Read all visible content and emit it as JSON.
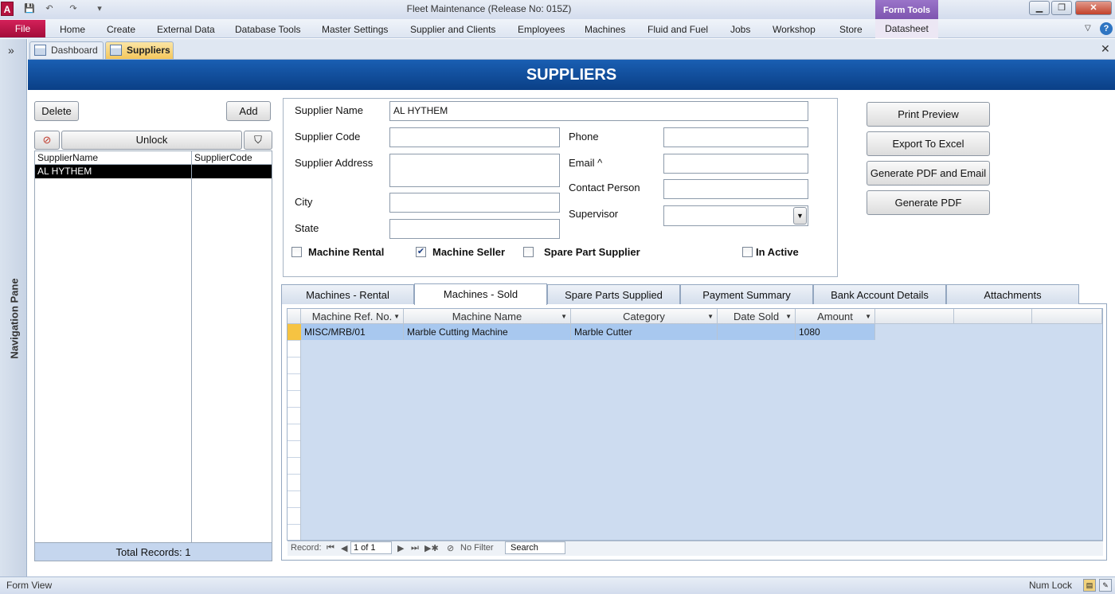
{
  "window": {
    "title": "Fleet Maintenance (Release No: 015Z)",
    "context_tab_group": "Form Tools",
    "app_icon_letter": "A"
  },
  "ribbon": {
    "file": "File",
    "tabs": [
      "Home",
      "Create",
      "External Data",
      "Database Tools",
      "Master Settings",
      "Supplier and Clients",
      "Employees",
      "Machines",
      "Fluid and Fuel",
      "Jobs",
      "Workshop",
      "Store"
    ],
    "context_tab": "Datasheet"
  },
  "nav_pane": {
    "label": "Navigation Pane",
    "toggle": "»"
  },
  "doc_tabs": [
    "Dashboard",
    "Suppliers"
  ],
  "header": {
    "title": "SUPPLIERS"
  },
  "left": {
    "delete_label": "Delete",
    "add_label": "Add",
    "unlock_label": "Unlock",
    "columns": [
      "SupplierName",
      "SupplierCode"
    ],
    "rows": [
      {
        "name": "AL HYTHEM",
        "code": ""
      }
    ],
    "total_records": "Total Records: 1"
  },
  "form": {
    "supplier_name_label": "Supplier Name",
    "supplier_name_value": "AL HYTHEM",
    "supplier_code_label": "Supplier Code",
    "supplier_code_value": "",
    "supplier_address_label": "Supplier Address",
    "supplier_address_value": "",
    "city_label": "City",
    "city_value": "",
    "state_label": "State",
    "state_value": "",
    "phone_label": "Phone",
    "phone_value": "",
    "email_label": "Email ^",
    "email_value": "",
    "contact_label": "Contact Person",
    "contact_value": "",
    "supervisor_label": "Supervisor",
    "supervisor_value": "",
    "checkboxes": [
      {
        "label": "Machine Rental",
        "checked": false
      },
      {
        "label": "Machine Seller",
        "checked": true
      },
      {
        "label": "Spare Part Supplier",
        "checked": false
      },
      {
        "label": "In Active",
        "checked": false
      }
    ]
  },
  "actions": [
    "Print Preview",
    "Export To Excel",
    "Generate PDF and Email",
    "Generate PDF"
  ],
  "subform": {
    "tabs": [
      "Machines - Rental",
      "Machines - Sold",
      "Spare Parts Supplied",
      "Payment Summary",
      "Bank Account Details",
      "Attachments"
    ],
    "active_tab": "Machines - Sold",
    "columns": [
      "Machine Ref. No.",
      "Machine Name",
      "Category",
      "Date Sold",
      "Amount"
    ],
    "rows": [
      {
        "ref": "MISC/MRB/01",
        "name": "Marble Cutting Machine",
        "category": "Marble Cutter",
        "date_sold": "",
        "amount": "1080"
      }
    ],
    "nav": {
      "record_label": "Record:",
      "position": "1 of 1",
      "filter_label": "No Filter",
      "search_label": "Search"
    }
  },
  "status": {
    "left": "Form View",
    "right": "Num Lock"
  }
}
